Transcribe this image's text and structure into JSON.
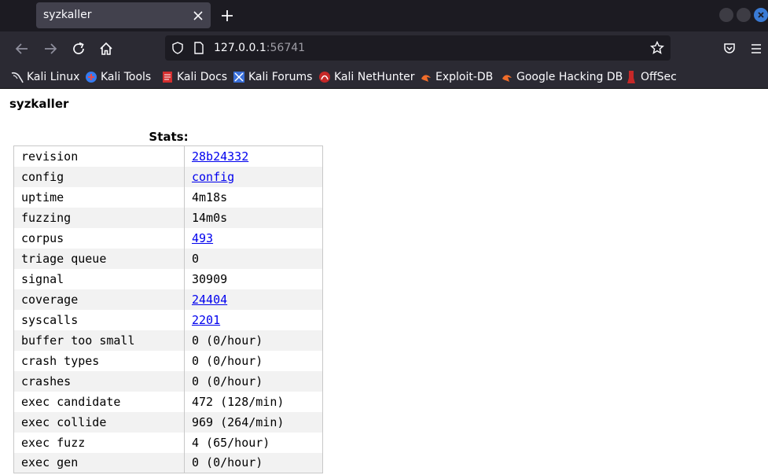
{
  "browser": {
    "tab_title": "syzkaller",
    "url_host": "127.0.0.1",
    "url_port": ":56741",
    "bookmarks": [
      {
        "label": "Kali Linux",
        "icon": "kali-dragon-icon"
      },
      {
        "label": "Kali Tools",
        "icon": "kali-tools-icon"
      },
      {
        "label": "Kali Docs",
        "icon": "kali-docs-icon"
      },
      {
        "label": "Kali Forums",
        "icon": "kali-forums-icon"
      },
      {
        "label": "Kali NetHunter",
        "icon": "kali-nethunter-icon"
      },
      {
        "label": "Exploit-DB",
        "icon": "exploit-db-icon"
      },
      {
        "label": "Google Hacking DB",
        "icon": "google-hacking-db-icon"
      },
      {
        "label": "OffSec",
        "icon": "offsec-icon"
      }
    ],
    "colors": {
      "chrome_dark": "#1c1b22",
      "toolbar": "#2b2a33",
      "tab_active": "#42414d",
      "close_button": "#3a7bd5"
    }
  },
  "page": {
    "title": "syzkaller",
    "stats_caption": "Stats:",
    "stats": [
      {
        "key": "revision",
        "value": "28b24332",
        "link": true
      },
      {
        "key": "config",
        "value": "config",
        "link": true
      },
      {
        "key": "uptime",
        "value": "4m18s",
        "link": false
      },
      {
        "key": "fuzzing",
        "value": "14m0s",
        "link": false
      },
      {
        "key": "corpus",
        "value": "493",
        "link": true
      },
      {
        "key": "triage queue",
        "value": "0",
        "link": false
      },
      {
        "key": "signal",
        "value": "30909",
        "link": false
      },
      {
        "key": "coverage",
        "value": "24404",
        "link": true
      },
      {
        "key": "syscalls",
        "value": "2201",
        "link": true
      },
      {
        "key": "buffer too small",
        "value": "0 (0/hour)",
        "link": false
      },
      {
        "key": "crash types",
        "value": "0 (0/hour)",
        "link": false
      },
      {
        "key": "crashes",
        "value": "0 (0/hour)",
        "link": false
      },
      {
        "key": "exec candidate",
        "value": "472 (128/min)",
        "link": false
      },
      {
        "key": "exec collide",
        "value": "969 (264/min)",
        "link": false
      },
      {
        "key": "exec fuzz",
        "value": "4 (65/hour)",
        "link": false
      },
      {
        "key": "exec gen",
        "value": "0 (0/hour)",
        "link": false
      }
    ],
    "colors": {
      "link": "#0000ee",
      "row_alt": "#f2f2f2",
      "border": "#c8c8c8"
    }
  }
}
